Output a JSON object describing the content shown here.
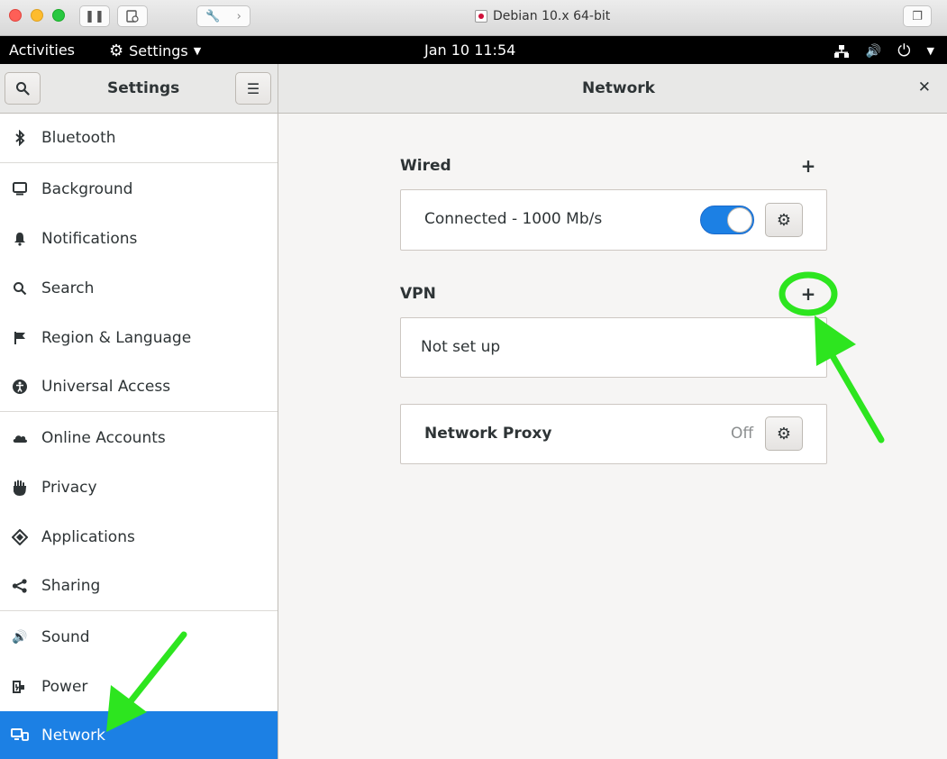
{
  "vm_window": {
    "title": "Debian 10.x 64-bit"
  },
  "topbar": {
    "activities": "Activities",
    "app_menu": "Settings",
    "clock": "Jan 10  11:54"
  },
  "headerbar": {
    "sidebar_title": "Settings",
    "page_title": "Network"
  },
  "sidebar": {
    "items": [
      {
        "label": "Bluetooth",
        "icon": "bluetooth-icon"
      },
      {
        "label": "Background",
        "icon": "background-icon"
      },
      {
        "label": "Notifications",
        "icon": "bell-icon"
      },
      {
        "label": "Search",
        "icon": "search-icon"
      },
      {
        "label": "Region & Language",
        "icon": "flag-icon"
      },
      {
        "label": "Universal Access",
        "icon": "accessibility-icon"
      },
      {
        "label": "Online Accounts",
        "icon": "cloud-icon"
      },
      {
        "label": "Privacy",
        "icon": "hand-icon"
      },
      {
        "label": "Applications",
        "icon": "applications-icon"
      },
      {
        "label": "Sharing",
        "icon": "share-icon"
      },
      {
        "label": "Sound",
        "icon": "speaker-icon"
      },
      {
        "label": "Power",
        "icon": "power-plug-icon"
      },
      {
        "label": "Network",
        "icon": "network-icon"
      }
    ],
    "active": "Network"
  },
  "network": {
    "wired": {
      "title": "Wired",
      "status": "Connected - 1000 Mb/s",
      "enabled": true
    },
    "vpn": {
      "title": "VPN",
      "status": "Not set up"
    },
    "proxy": {
      "title": "Network Proxy",
      "status": "Off"
    }
  },
  "colors": {
    "accent": "#1c80e4",
    "annotation": "#2de51f"
  }
}
